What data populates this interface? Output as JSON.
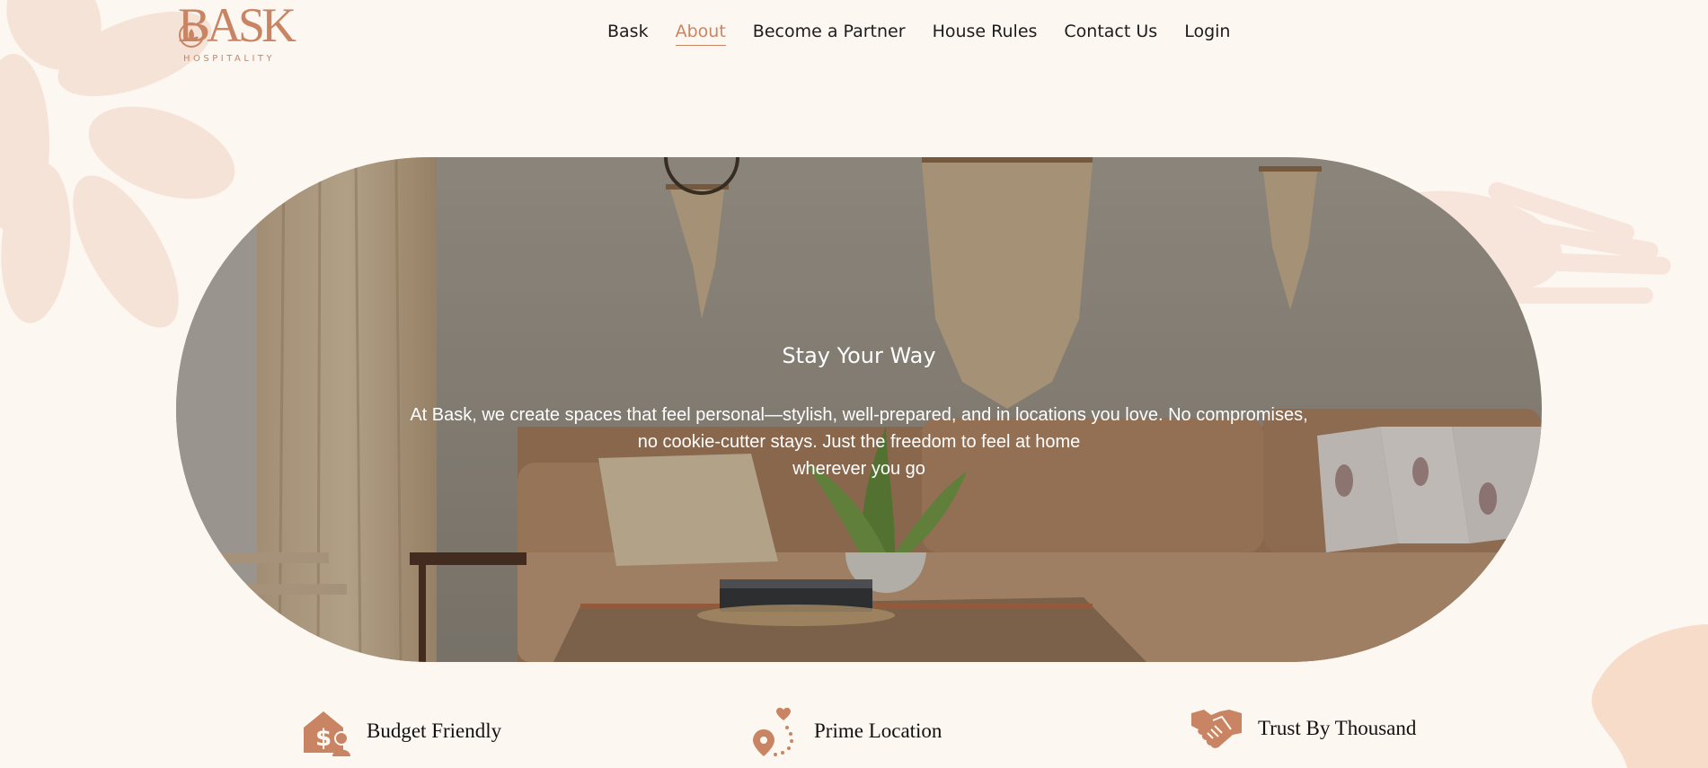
{
  "brand": {
    "name": "BASK",
    "subtitle": "HOSPITALITY",
    "logo_icon": "bask-logo-emblem"
  },
  "nav": {
    "items": [
      {
        "label": "Bask",
        "active": false
      },
      {
        "label": "About",
        "active": true
      },
      {
        "label": "Become a Partner",
        "active": false
      },
      {
        "label": "House Rules",
        "active": false
      },
      {
        "label": "Contact Us",
        "active": false
      },
      {
        "label": "Login",
        "active": false
      }
    ]
  },
  "hero": {
    "title": "Stay Your Way",
    "text_lines": [
      "At Bask, we create spaces that feel personal—stylish, well-prepared, and in locations you love. No compromises,",
      "no cookie-cutter stays. Just the freedom to feel at home",
      "wherever you go"
    ]
  },
  "features": [
    {
      "label": "Budget Friendly",
      "icon": "budget-house-dollar-icon"
    },
    {
      "label": "Prime Location",
      "icon": "location-pin-heart-icon"
    },
    {
      "label": "Trust By Thousand",
      "icon": "handshake-icon"
    }
  ],
  "colors": {
    "accent": "#c98563",
    "background": "#fdf7f2",
    "decor": "#f5e2d6"
  }
}
